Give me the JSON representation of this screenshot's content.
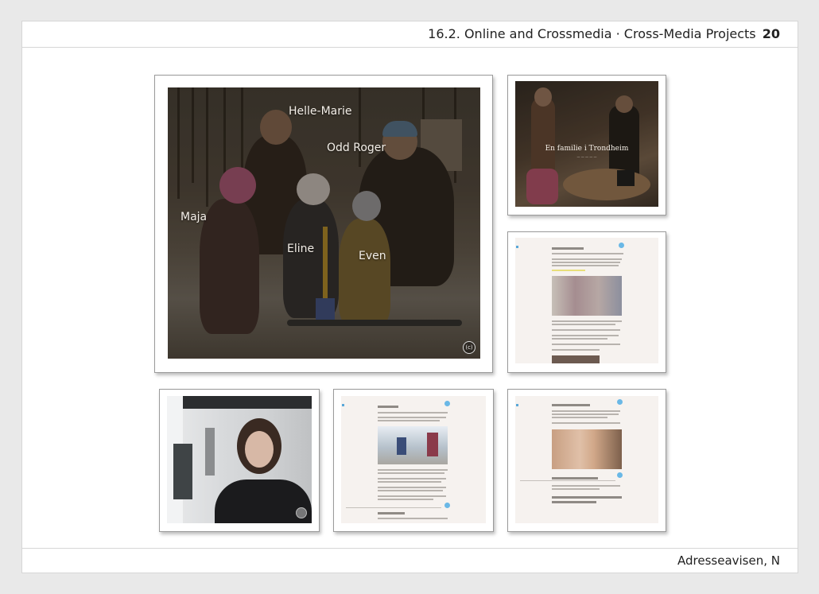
{
  "header": {
    "section": "16.2. Online and Crossmedia · Cross-Media Projects",
    "page_number": "20"
  },
  "footer": {
    "credit": "Adresseavisen, N"
  },
  "family_photo": {
    "names": [
      "Helle-Marie",
      "Odd Roger",
      "Maja",
      "Eline",
      "Even"
    ],
    "badge": "(c)"
  },
  "kitchen_frame": {
    "title": "En familie i Trondheim",
    "subtitle": "— — — — —"
  },
  "colors": {
    "accent_blue": "#6ab8e6",
    "page_bg": "#e9e9e9",
    "article_bg": "#f6f2ef"
  }
}
